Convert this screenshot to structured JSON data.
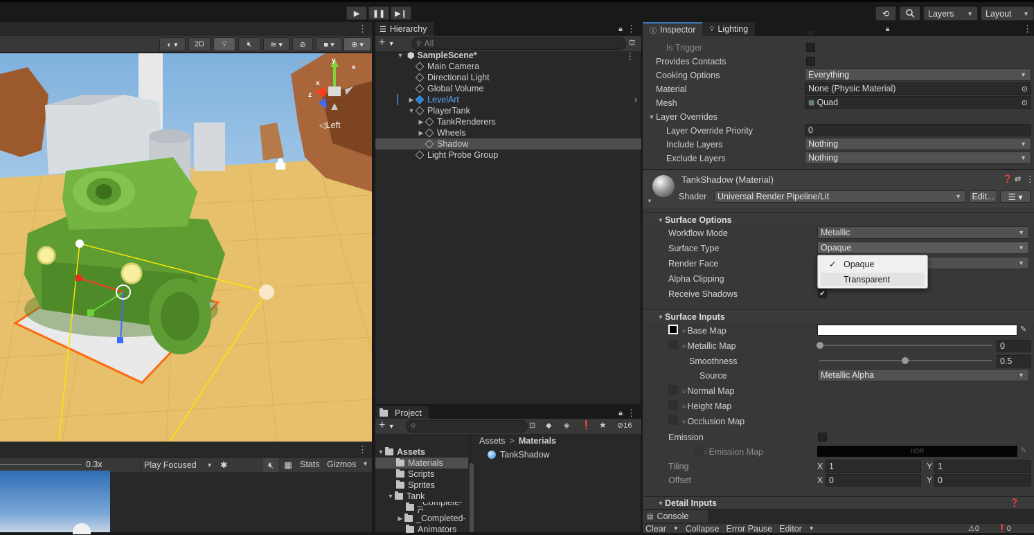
{
  "toolbar": {
    "layers_label": "Layers",
    "layout_label": "Layout"
  },
  "scene": {
    "mode_2d": "2D",
    "gizmo_axis": {
      "x": "x",
      "y": "y",
      "z": "z"
    },
    "view_label": "◁Left"
  },
  "game": {
    "scale": "0.3x",
    "play_mode": "Play Focused",
    "stats": "Stats",
    "gizmos": "Gizmos"
  },
  "hierarchy": {
    "title": "Hierarchy",
    "search_placeholder": "All",
    "scene_name": "SampleScene*",
    "items": [
      {
        "label": "Main Camera"
      },
      {
        "label": "Directional Light"
      },
      {
        "label": "Global Volume"
      },
      {
        "label": "LevelArt"
      },
      {
        "label": "PlayerTank"
      },
      {
        "label": "TankRenderers"
      },
      {
        "label": "Wheels"
      },
      {
        "label": "Shadow"
      },
      {
        "label": "Light Probe Group"
      }
    ]
  },
  "project": {
    "title": "Project",
    "hidden_count": "16",
    "tree": [
      {
        "label": "Assets"
      },
      {
        "label": "Materials"
      },
      {
        "label": "Scripts"
      },
      {
        "label": "Sprites"
      },
      {
        "label": "Tank"
      },
      {
        "label": "_Complete-C"
      },
      {
        "label": "_Completed-"
      },
      {
        "label": "Animators"
      }
    ],
    "breadcrumb": {
      "root": "Assets",
      "sep": ">",
      "current": "Materials"
    },
    "asset": "TankShadow"
  },
  "inspector": {
    "tabs": [
      "Inspector",
      "Lighting"
    ],
    "collider": [
      {
        "label": "Is Trigger"
      },
      {
        "label": "Provides Contacts"
      },
      {
        "label": "Cooking Options",
        "value": "Everything"
      },
      {
        "label": "Material",
        "value": "None (Physic Material)"
      },
      {
        "label": "Mesh",
        "value": "Quad"
      }
    ],
    "layer_overrides": {
      "header": "Layer Overrides",
      "priority_label": "Layer Override Priority",
      "priority_value": "0",
      "include_label": "Include Layers",
      "include_value": "Nothing",
      "exclude_label": "Exclude Layers",
      "exclude_value": "Nothing"
    },
    "material": {
      "name": "TankShadow (Material)",
      "shader_label": "Shader",
      "shader_value": "Universal Render Pipeline/Lit",
      "edit_label": "Edit..."
    },
    "surface_options": {
      "header": "Surface Options",
      "workflow_label": "Workflow Mode",
      "workflow_value": "Metallic",
      "surface_type_label": "Surface Type",
      "surface_type_value": "Opaque",
      "render_face_label": "Render Face",
      "alpha_clip_label": "Alpha Clipping",
      "receive_shadows_label": "Receive Shadows"
    },
    "popup": {
      "options": [
        "Opaque",
        "Transparent"
      ],
      "selected": "Opaque",
      "checkmark": "✓"
    },
    "surface_inputs": {
      "header": "Surface Inputs",
      "base_map": "Base Map",
      "metallic_map": "Metallic Map",
      "metallic_value": "0",
      "smoothness": "Smoothness",
      "smoothness_value": "0.5",
      "source": "Source",
      "source_value": "Metallic Alpha",
      "normal_map": "Normal Map",
      "height_map": "Height Map",
      "occlusion_map": "Occlusion Map",
      "emission": "Emission",
      "emission_map": "Emission Map",
      "hdr": "HDR",
      "tiling": "Tiling",
      "tiling_x": "1",
      "tiling_y": "1",
      "offset": "Offset",
      "offset_x": "0",
      "offset_y": "0",
      "x_label": "X",
      "y_label": "Y"
    },
    "detail_inputs": {
      "header": "Detail Inputs"
    }
  },
  "console": {
    "title": "Console",
    "clear": "Clear",
    "collapse": "Collapse",
    "error_pause": "Error Pause",
    "editor": "Editor",
    "warn_count": "0",
    "err_count": "0"
  },
  "colors": {
    "accent": "#3a79bb",
    "selection": "#4d4d4d",
    "link_blue": "#5ea6ff",
    "tank_green": "#6aa83a",
    "ground": "#e8c36a",
    "outline_orange": "#ff6a10"
  }
}
